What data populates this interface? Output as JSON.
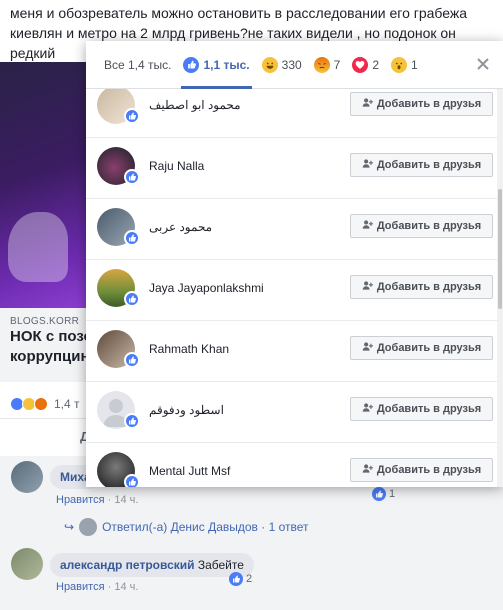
{
  "background": {
    "post_text": "меня и обозреватель можно остановить в расследовании его грабежа киевлян и метро на 2 млрд гривень?не таких видели , но подонок он редкий",
    "link_domain": "BLOGS.KORR",
    "link_title_line1": "НОК с позо",
    "link_title_line2": "коррупцин",
    "reaction_count": "1,4 т",
    "action_label": "Д",
    "comments": [
      {
        "author": "Миха",
        "text": "",
        "like_label": "Нравится",
        "time": "14 ч.",
        "reaction_count": "1"
      },
      {
        "author": "александр петровский",
        "text": "Забейте",
        "like_label": "Нравится",
        "time": "14 ч.",
        "reaction_count": "2"
      }
    ],
    "reply_link": "Ответил(-а) Денис Давыдов · 1 ответ"
  },
  "modal": {
    "tabs": [
      {
        "label": "Все 1,4 тыс.",
        "icon": "",
        "active": false
      },
      {
        "label": "1,1 тыс.",
        "icon": "like-icon",
        "active": true
      },
      {
        "label": "330",
        "icon": "haha-icon",
        "active": false
      },
      {
        "label": "7",
        "icon": "angry-icon",
        "active": false
      },
      {
        "label": "2",
        "icon": "love-icon",
        "active": false
      },
      {
        "label": "1",
        "icon": "wow-icon",
        "active": false
      }
    ],
    "add_friend_label": "Добавить в друзья",
    "people": [
      {
        "name": "محمود ابو اصطيف"
      },
      {
        "name": "Raju Nalla"
      },
      {
        "name": "محمود عربى"
      },
      {
        "name": "Jaya Jayaponlakshmi"
      },
      {
        "name": "Rahmath Khan"
      },
      {
        "name": "اسطود ودفوقم"
      },
      {
        "name": "Mental Jutt Msf"
      }
    ]
  },
  "colors": {
    "accent": "#4267b2",
    "like_blue": "#4a7cf7",
    "haha_yellow": "#f7c23b",
    "angry_orange": "#e9710f",
    "love_red": "#f0284a"
  }
}
